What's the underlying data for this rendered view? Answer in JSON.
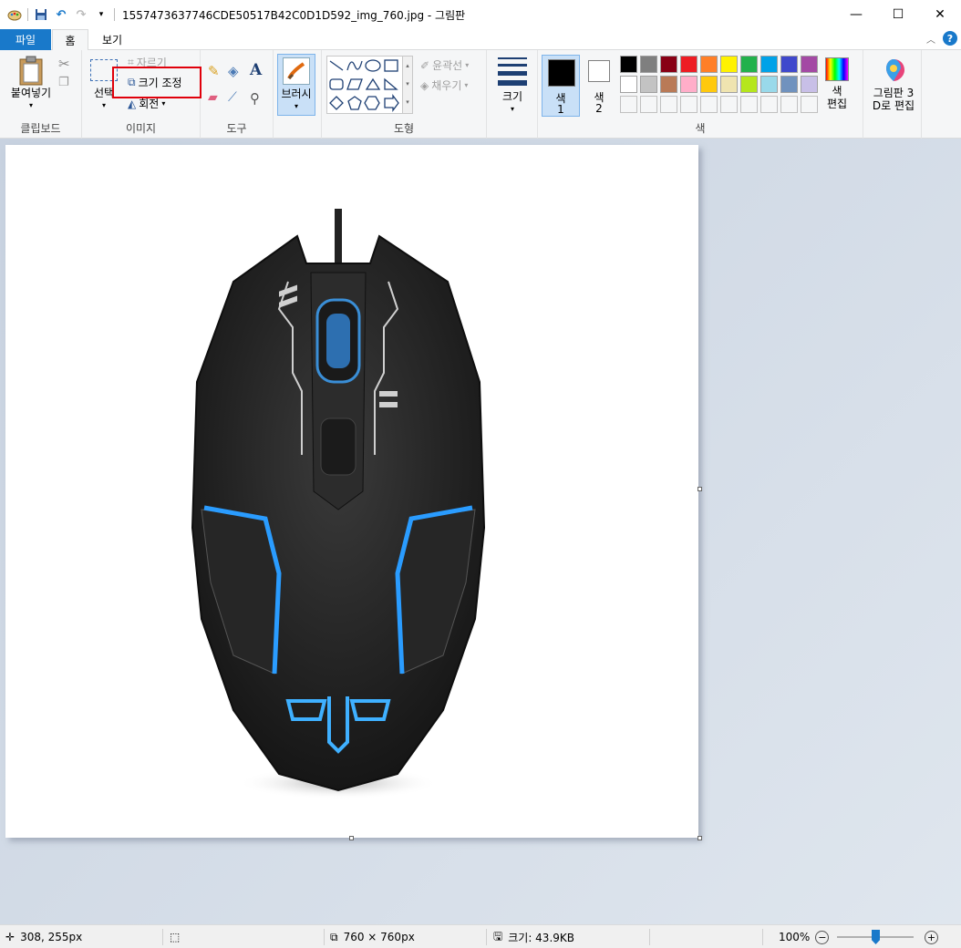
{
  "titlebar": {
    "title": "1557473637746CDE50517B42C0D1D592_img_760.jpg - 그림판",
    "minimize": "—",
    "maximize": "☐",
    "close": "✕"
  },
  "tabs": {
    "file": "파일",
    "home": "홈",
    "view": "보기"
  },
  "ribbon": {
    "clipboard": {
      "label": "클립보드",
      "paste": "붙여넣기"
    },
    "image": {
      "label": "이미지",
      "select": "선택",
      "crop": "자르기",
      "resize": "크기 조정",
      "rotate": "회전"
    },
    "tools": {
      "label": "도구"
    },
    "brush": {
      "label": "브러시"
    },
    "shapes": {
      "label": "도형",
      "outline": "윤곽선",
      "fill": "채우기"
    },
    "size": {
      "label": "크기"
    },
    "colors": {
      "label": "색",
      "color1": "색",
      "color1_num": "1",
      "color2": "색",
      "color2_num": "2",
      "edit_colors_1": "색",
      "edit_colors_2": "편집",
      "paint3d_1": "그림판 3",
      "paint3d_2": "D로 편집",
      "palette": [
        "#000000",
        "#7f7f7f",
        "#880015",
        "#ed1c24",
        "#ff7f27",
        "#fff200",
        "#22b14c",
        "#00a2e8",
        "#3f48cc",
        "#a349a4",
        "#ffffff",
        "#c3c3c3",
        "#b97a57",
        "#ffaec9",
        "#ffc90e",
        "#efe4b0",
        "#b5e61d",
        "#99d9ea",
        "#7092be",
        "#c8bfe7"
      ]
    }
  },
  "statusbar": {
    "cursor_pos": "308, 255px",
    "image_size": "760 × 760px",
    "file_size": "크기: 43.9KB",
    "zoom": "100%"
  }
}
